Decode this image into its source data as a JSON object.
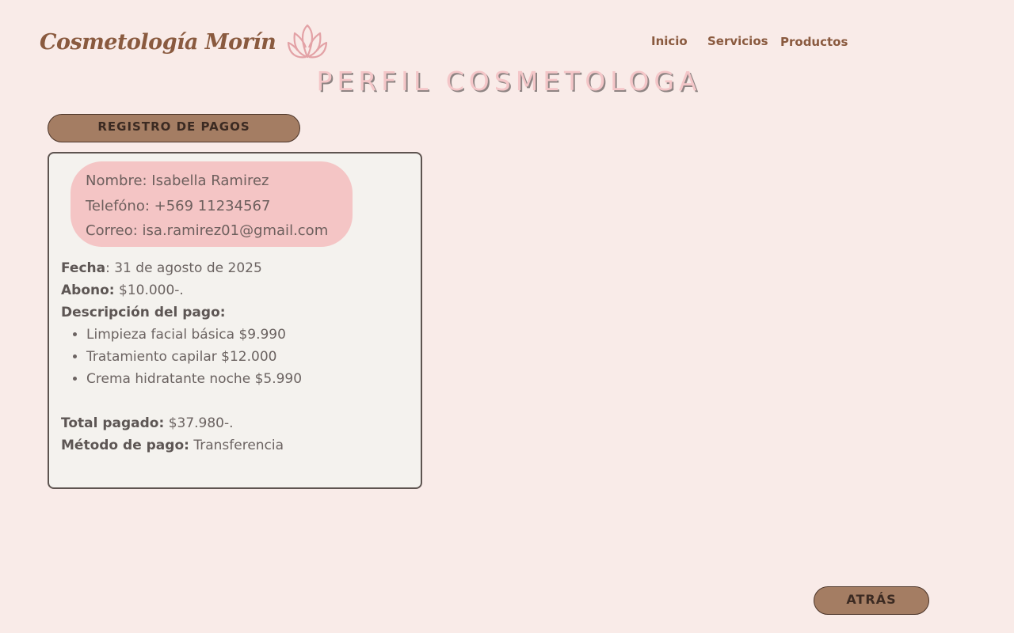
{
  "header": {
    "brand": "Cosmetología Morín",
    "logo_icon": "lotus-icon",
    "nav": [
      {
        "label": "Inicio"
      },
      {
        "label": "Servicios"
      },
      {
        "label": "Productos"
      }
    ]
  },
  "page": {
    "title": "PERFIL COSMETOLOGA"
  },
  "actions": {
    "registro_label": "REGISTRO DE PAGOS",
    "atras_label": "ATRÁS"
  },
  "contact": {
    "nombre": "Nombre: Isabella Ramirez",
    "telefono": "Telefóno: +569 11234567",
    "correo": "Correo: isa.ramirez01@gmail.com"
  },
  "payment": {
    "fecha_label": "Fecha",
    "fecha_value": ": 31 de agosto de 2025",
    "abono_label": "Abono:",
    "abono_value": " $10.000-.",
    "descripcion_label": "Descripción del pago:",
    "items": [
      "Limpieza facial básica $9.990",
      "Tratamiento capilar $12.000",
      "Crema hidratante noche $5.990"
    ],
    "total_label": "Total pagado:",
    "total_value": " $37.980-.",
    "metodo_label": "Método de pago:",
    "metodo_value": " Transferencia"
  },
  "colors": {
    "background": "#f9ebe8",
    "brand": "#8a5a3f",
    "button": "#a47d63",
    "card": "#f4f2ee",
    "contact_pill": "#f4c5c5",
    "title": "#f4c6c8"
  }
}
